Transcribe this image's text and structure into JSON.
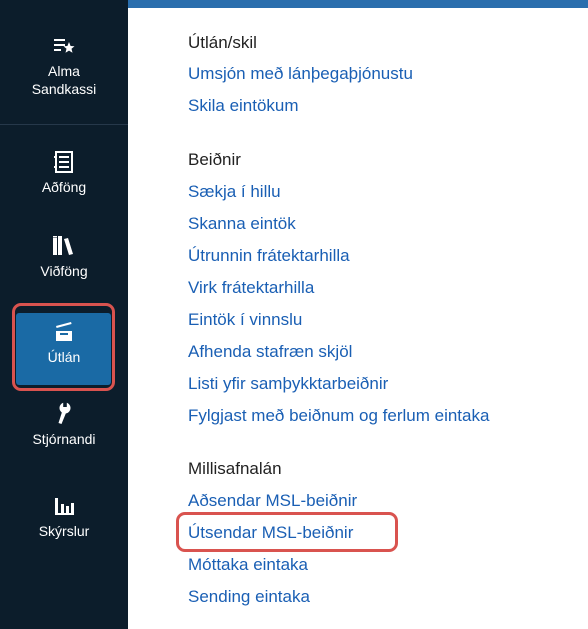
{
  "sidebar": {
    "items": [
      {
        "label": "Alma\nSandkassi",
        "icon": "menu-star-icon"
      },
      {
        "label": "Aðföng",
        "icon": "ledger-icon"
      },
      {
        "label": "Viðföng",
        "icon": "books-icon"
      },
      {
        "label": "Útlán",
        "icon": "tray-icon",
        "active": true
      },
      {
        "label": "Stjórnandi",
        "icon": "wrench-icon"
      },
      {
        "label": "Skýrslur",
        "icon": "bar-chart-icon"
      }
    ]
  },
  "menu": {
    "sections": [
      {
        "title": "Útlán/skil",
        "links": [
          "Umsjón með lánþegaþjónustu",
          "Skila eintökum"
        ]
      },
      {
        "title": "Beiðnir",
        "links": [
          "Sækja í hillu",
          "Skanna eintök",
          "Útrunnin frátektarhilla",
          "Virk frátektarhilla",
          "Eintök í vinnslu",
          "Afhenda stafræn skjöl",
          "Listi yfir samþykktarbeiðnir",
          "Fylgjast með beiðnum og ferlum eintaka"
        ]
      },
      {
        "title": "Millisafnalán",
        "links": [
          "Aðsendar MSL-beiðnir",
          "Útsendar MSL-beiðnir",
          "Móttaka eintaka",
          "Sending eintaka"
        ]
      }
    ]
  },
  "colors": {
    "sidebar_bg": "#0c1d2b",
    "active_bg": "#1a6aa5",
    "link": "#1a5fb4",
    "highlight": "#d9534f",
    "topbar": "#2a6ead"
  }
}
